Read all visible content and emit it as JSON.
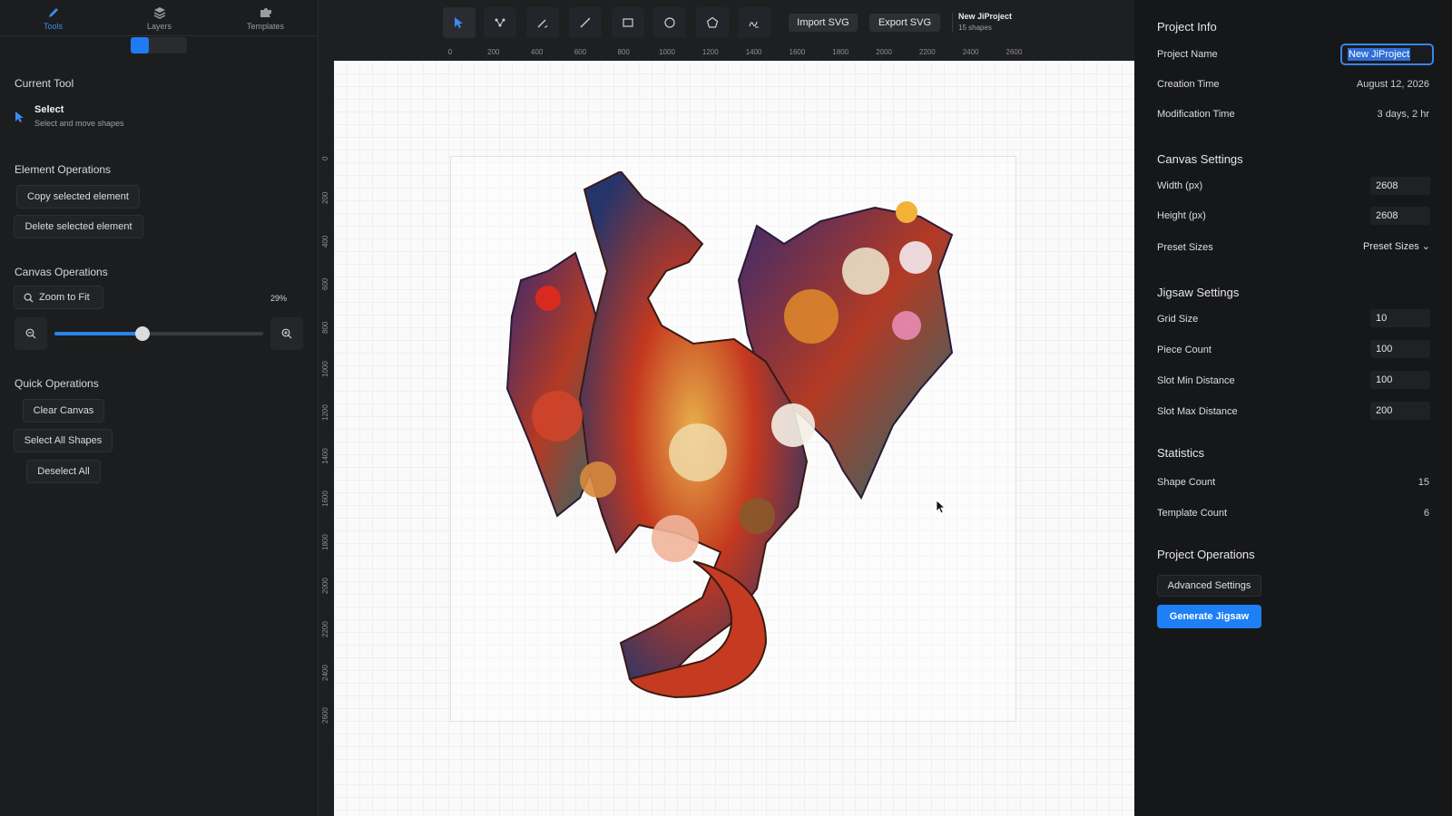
{
  "left_tabs": [
    {
      "label": "Tools",
      "icon": "pen-icon"
    },
    {
      "label": "Layers",
      "icon": "layers-icon"
    },
    {
      "label": "Templates",
      "icon": "puzzle-icon"
    }
  ],
  "current_tool": {
    "title": "Current Tool",
    "name": "Select",
    "description": "Select and move shapes"
  },
  "element_ops": {
    "title": "Element Operations",
    "copy_label": "Copy selected element",
    "delete_label": "Delete selected element"
  },
  "canvas_ops": {
    "title": "Canvas Operations",
    "zoom_fit_label": "Zoom to Fit",
    "zoom_percent": "29%",
    "zoom_slider_fraction": 0.42
  },
  "quick_ops": {
    "title": "Quick Operations",
    "clear_label": "Clear Canvas",
    "select_all_label": "Select All Shapes",
    "deselect_label": "Deselect All"
  },
  "toolbar": {
    "tools": [
      "select-tool",
      "node-tool",
      "pen-tool",
      "line-tool",
      "rectangle-tool",
      "circle-tool",
      "polygon-tool",
      "signature-tool"
    ],
    "import_label": "Import SVG",
    "export_label": "Export SVG",
    "project_name": "New JiProject",
    "shape_count_text": "15 shapes"
  },
  "rulers": {
    "horizontal": [
      "0",
      "200",
      "400",
      "600",
      "800",
      "1000",
      "1200",
      "1400",
      "1600",
      "1800",
      "2000",
      "2200",
      "2400",
      "2600"
    ],
    "vertical": [
      "0",
      "200",
      "400",
      "600",
      "800",
      "1000",
      "1200",
      "1400",
      "1600",
      "1800",
      "2000",
      "2200",
      "2400",
      "2600"
    ]
  },
  "project_info": {
    "title": "Project Info",
    "name_label": "Project Name",
    "name_value": "New JiProject",
    "creation_label": "Creation Time",
    "creation_value": "August 12, 2026",
    "modification_label": "Modification Time",
    "modification_value": "3 days, 2 hr"
  },
  "canvas_settings": {
    "title": "Canvas Settings",
    "width_label": "Width (px)",
    "width_value": "2608",
    "height_label": "Height (px)",
    "height_value": "2608",
    "preset_label": "Preset Sizes",
    "preset_value": "Preset Sizes"
  },
  "jigsaw_settings": {
    "title": "Jigsaw Settings",
    "grid_label": "Grid Size",
    "grid_value": "10",
    "piece_label": "Piece Count",
    "piece_value": "100",
    "slot_min_label": "Slot Min Distance",
    "slot_min_value": "100",
    "slot_max_label": "Slot Max Distance",
    "slot_max_value": "200"
  },
  "statistics": {
    "title": "Statistics",
    "shape_label": "Shape Count",
    "shape_value": "15",
    "template_label": "Template Count",
    "template_value": "6"
  },
  "project_ops": {
    "title": "Project Operations",
    "advanced_label": "Advanced Settings",
    "generate_label": "Generate Jigsaw"
  },
  "colors": {
    "accent": "#1f7ff5",
    "panel_bg": "#1c1d1f",
    "canvas_bg": "#fafafa"
  }
}
